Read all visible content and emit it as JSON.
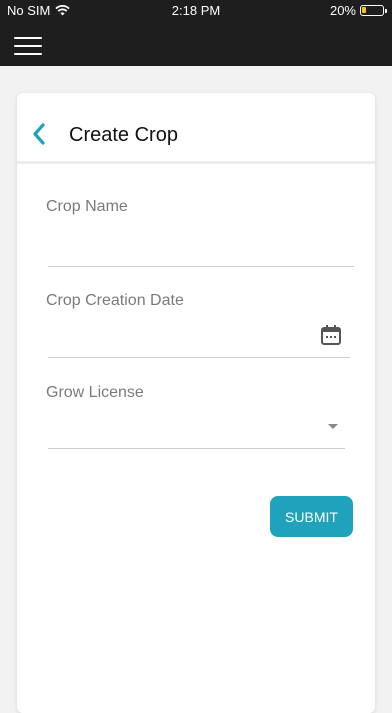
{
  "status_bar": {
    "carrier": "No SIM",
    "time": "2:18 PM",
    "battery_percent": "20%",
    "battery_level": 0.2,
    "battery_color": "#f5c518"
  },
  "header": {
    "menu_icon": "hamburger-menu-icon",
    "background": "#1e1e1e"
  },
  "page": {
    "title": "Create Crop",
    "back_icon": "chevron-left-icon",
    "accent": "#1fa3bd"
  },
  "form": {
    "crop_name": {
      "label": "Crop Name",
      "value": ""
    },
    "creation_date": {
      "label": "Crop Creation Date",
      "value": "",
      "icon": "calendar-icon"
    },
    "grow_license": {
      "label": "Grow License",
      "value": "",
      "icon": "dropdown-caret-icon"
    },
    "submit_label": "SUBMIT"
  }
}
